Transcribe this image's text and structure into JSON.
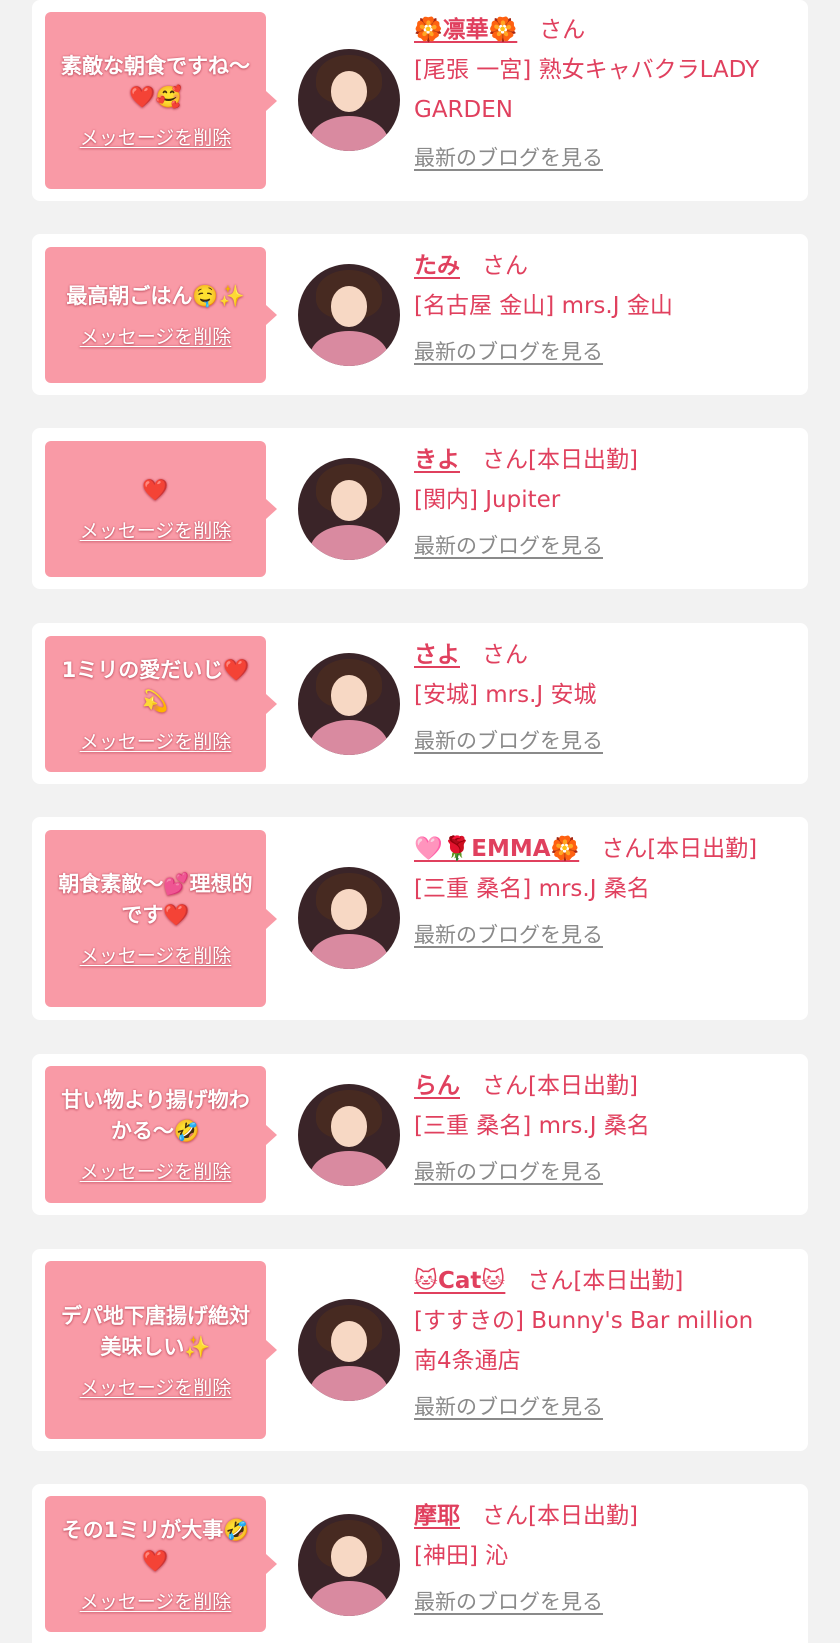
{
  "messages": [
    {
      "message": "素敵な朝食ですね〜❤️🥰",
      "delete_label": "メッセージを削除",
      "girl_name": "🏵️凛華🏵️",
      "honorific": "さん",
      "shop": "[尾張 一宮] 熟女キャバクラLADY GARDEN",
      "blog_label": "最新のブログを見る"
    },
    {
      "message": "最高朝ごはん🤤✨",
      "delete_label": "メッセージを削除",
      "girl_name": "たみ",
      "honorific": "さん",
      "shop": "[名古屋 金山] mrs.J 金山",
      "blog_label": "最新のブログを見る"
    },
    {
      "message": "❤️",
      "delete_label": "メッセージを削除",
      "girl_name": "きよ",
      "honorific": "さん[本日出勤]",
      "shop": "[関内] Jupiter",
      "blog_label": "最新のブログを見る"
    },
    {
      "message": "1ミリの愛だいじ❤️💫",
      "delete_label": "メッセージを削除",
      "girl_name": "さよ",
      "honorific": "さん",
      "shop": "[安城] mrs.J 安城",
      "blog_label": "最新のブログを見る"
    },
    {
      "message": "朝食素敵〜💕理想的です❤️",
      "delete_label": "メッセージを削除",
      "girl_name": "🩷🌹EMMA🏵️",
      "honorific": "さん[本日出勤]",
      "shop": "[三重 桑名] mrs.J 桑名",
      "blog_label": "最新のブログを見る"
    },
    {
      "message": "甘い物より揚げ物わかる〜🤣",
      "delete_label": "メッセージを削除",
      "girl_name": "らん",
      "honorific": "さん[本日出勤]",
      "shop": "[三重 桑名] mrs.J 桑名",
      "blog_label": "最新のブログを見る"
    },
    {
      "message": "デパ地下唐揚げ絶対美味しい✨",
      "delete_label": "メッセージを削除",
      "girl_name": "🐱Cat🐱",
      "honorific": "さん[本日出勤]",
      "shop": "[すすきの] Bunny's Bar million 南4条通店",
      "blog_label": "最新のブログを見る"
    },
    {
      "message": "その1ミリが大事🤣❤️",
      "delete_label": "メッセージを削除",
      "girl_name": "摩耶",
      "honorific": "さん[本日出勤]",
      "shop": "[神田] 沁",
      "blog_label": "最新のブログを見る"
    }
  ],
  "colors": {
    "page_bg": "#f2f2f2",
    "card_bg": "#ffffff",
    "bubble_bg": "#f99aa6",
    "name_color": "#e0405e",
    "blog_link_color": "#8a8a8a"
  }
}
